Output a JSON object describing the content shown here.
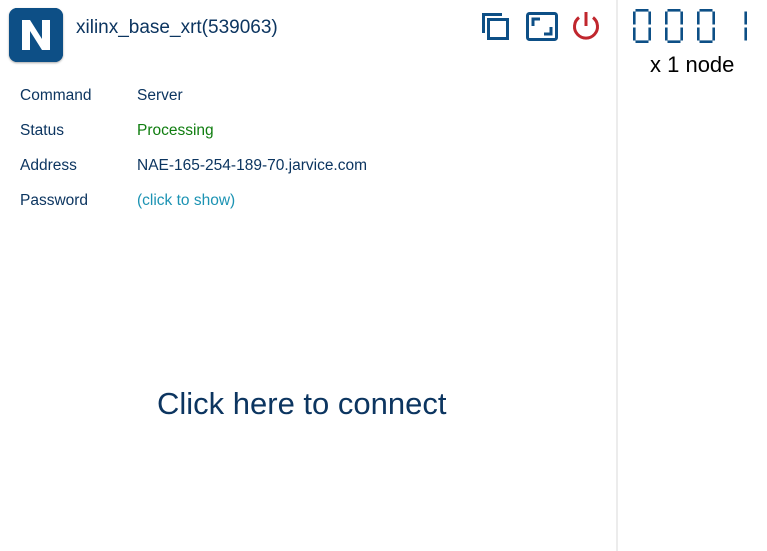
{
  "app": {
    "logo_letter": "N",
    "job_title": "xilinx_base_xrt(539063)"
  },
  "toolbar": {
    "icons": [
      "copy-icon",
      "fullscreen-icon",
      "power-icon"
    ],
    "power_color": "#c0262d",
    "icon_color": "#0d4f86"
  },
  "info": {
    "command_label": "Command",
    "command_value": "Server",
    "status_label": "Status",
    "status_value": "Processing",
    "address_label": "Address",
    "address_value": "NAE-165-254-189-70.jarvice.com",
    "password_label": "Password",
    "password_value": "(click to show)"
  },
  "connect": {
    "label": "Click here to connect"
  },
  "nodes": {
    "digits": [
      "0",
      "0",
      "0",
      "1"
    ],
    "label": "x 1 node"
  },
  "colors": {
    "brand": "#0d4f86",
    "text": "#0c3560",
    "status_processing": "#0f7d0f",
    "link": "#1c93b3"
  }
}
